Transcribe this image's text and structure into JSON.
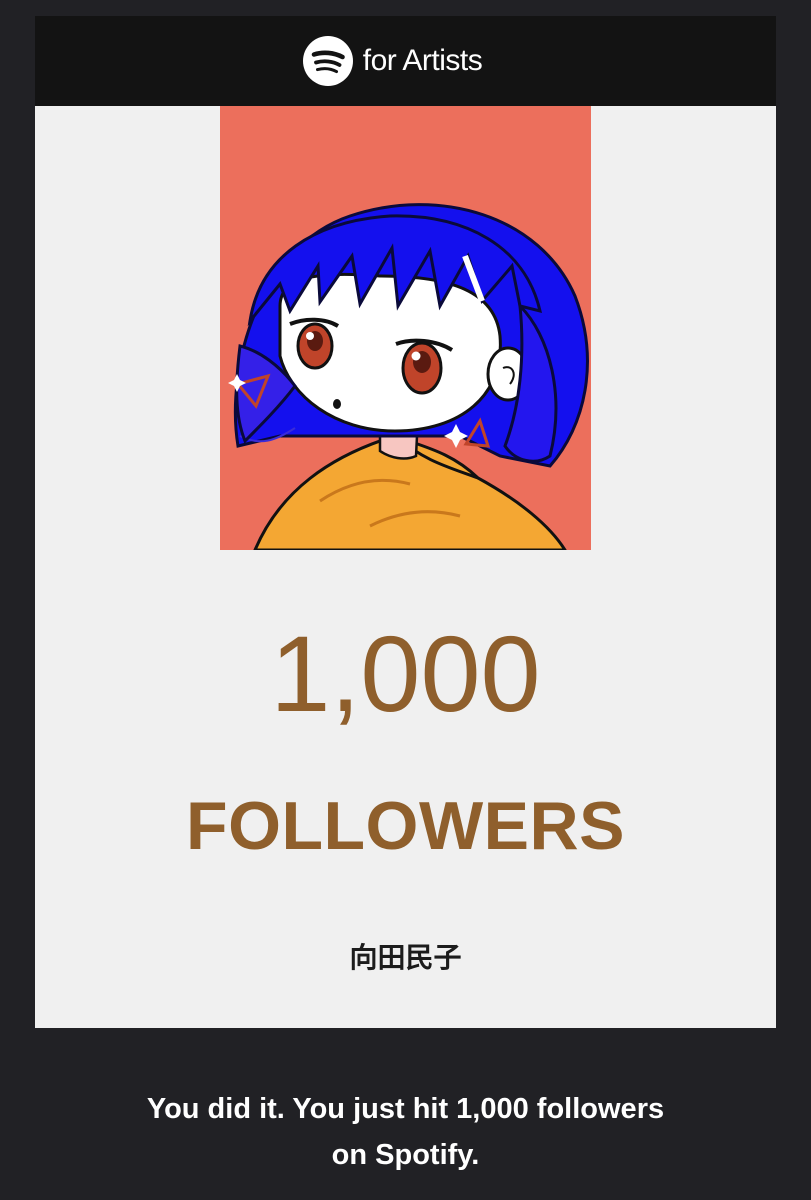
{
  "brand": {
    "logo_icon": "spotify-logo-icon",
    "text": "for Artists"
  },
  "artwork": {
    "icon": "artist-illustration",
    "background_color": "#ec6f5c"
  },
  "milestone": {
    "count": "1,000",
    "label": "FOLLOWERS",
    "color": "#8f5f2c"
  },
  "artist": {
    "name": "向田民子"
  },
  "message": {
    "line1": "You did it. You just hit 1,000 followers",
    "line2": "on Spotify."
  }
}
